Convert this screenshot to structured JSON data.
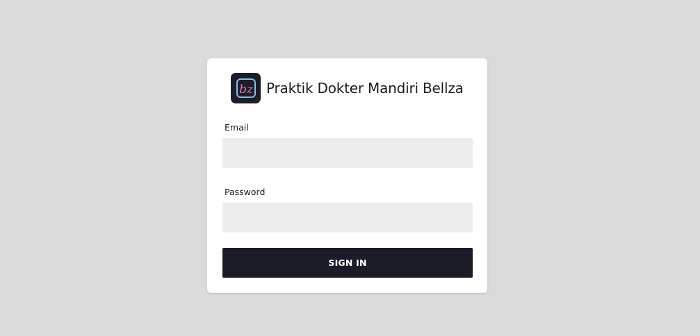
{
  "brand": {
    "title": "Praktik Dokter Mandiri Bellza",
    "logo_icon": "bz-monogram-logo-icon",
    "logo_text": "bz",
    "logo_bg_color": "#1c1d28",
    "logo_accent_color": "#e07ba8",
    "logo_frame_color": "#7ec3e0"
  },
  "form": {
    "email_label": "Email",
    "email_value": "",
    "password_label": "Password",
    "password_value": "",
    "submit_label": "SIGN IN"
  },
  "colors": {
    "page_background": "#dbdbdb",
    "card_background": "#ffffff",
    "input_background": "#ececec",
    "button_background": "#1b1c28",
    "button_text": "#ffffff"
  }
}
